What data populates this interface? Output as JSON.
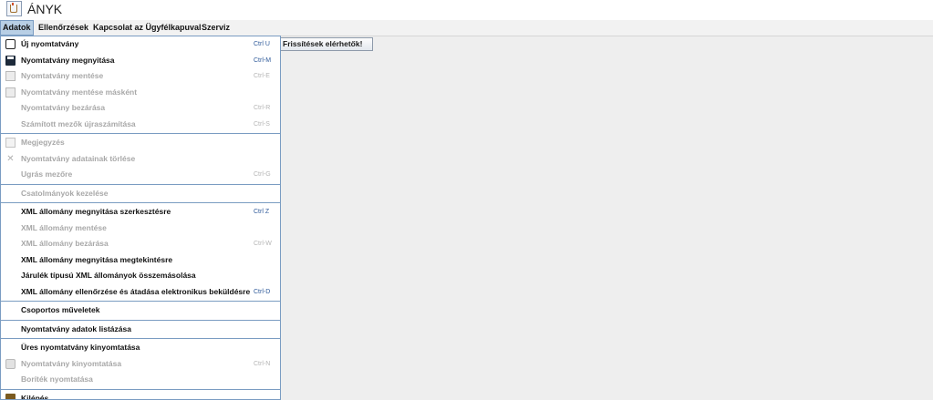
{
  "app": {
    "title": "ÁNYK"
  },
  "menubar": {
    "items": [
      {
        "label": "Adatok"
      },
      {
        "label": "Ellenőrzések"
      },
      {
        "label": "Kapcsolat az Ügyfélkapuval"
      },
      {
        "label": "Szerviz"
      }
    ]
  },
  "toolbar": {
    "update_label": "Frissítések elérhetők!"
  },
  "dropdown": {
    "items": [
      {
        "label": "Új nyomtatvány",
        "shortcut": "Ctrl U",
        "icon": "new-form-icon"
      },
      {
        "label": "Nyomtatvány megnyitása",
        "shortcut": "Ctrl-M",
        "icon": "open-form-icon"
      },
      {
        "label": "Nyomtatvány mentése",
        "shortcut": "Ctrl-E",
        "icon": "save-icon"
      },
      {
        "label": "Nyomtatvány mentése másként",
        "shortcut": "",
        "icon": "save-as-icon"
      },
      {
        "label": "Nyomtatvány bezárása",
        "shortcut": "Ctrl-R"
      },
      {
        "label": "Számított mezők újraszámítása",
        "shortcut": "Ctrl-S"
      },
      {
        "label": "Megjegyzés",
        "shortcut": "",
        "icon": "note-icon"
      },
      {
        "label": "Nyomtatvány adatainak törlése",
        "shortcut": "",
        "icon": "delete-icon"
      },
      {
        "label": "Ugrás mezőre",
        "shortcut": "Ctrl-G"
      },
      {
        "label": "Csatolmányok kezelése",
        "shortcut": ""
      },
      {
        "label": "XML állomány megnyitása szerkesztésre",
        "shortcut": "Ctrl Z"
      },
      {
        "label": "XML állomány mentése",
        "shortcut": ""
      },
      {
        "label": "XML állomány bezárása",
        "shortcut": "Ctrl-W"
      },
      {
        "label": "XML állomány megnyitása megtekintésre",
        "shortcut": ""
      },
      {
        "label": "Járulék típusú XML állományok összemásolása",
        "shortcut": ""
      },
      {
        "label": "XML állomány ellenőrzése és átadása elektronikus beküldésre",
        "shortcut": "Ctrl-D"
      },
      {
        "label": "Csoportos műveletek",
        "shortcut": ""
      },
      {
        "label": "Nyomtatvány adatok listázása",
        "shortcut": ""
      },
      {
        "label": "Üres nyomtatvány kinyomtatása",
        "shortcut": ""
      },
      {
        "label": "Nyomtatvány kinyomtatása",
        "shortcut": "Ctrl-N",
        "icon": "print-icon"
      },
      {
        "label": "Boríték nyomtatása",
        "shortcut": ""
      },
      {
        "label": "Kilépés",
        "shortcut": "",
        "icon": "exit-icon"
      }
    ]
  }
}
